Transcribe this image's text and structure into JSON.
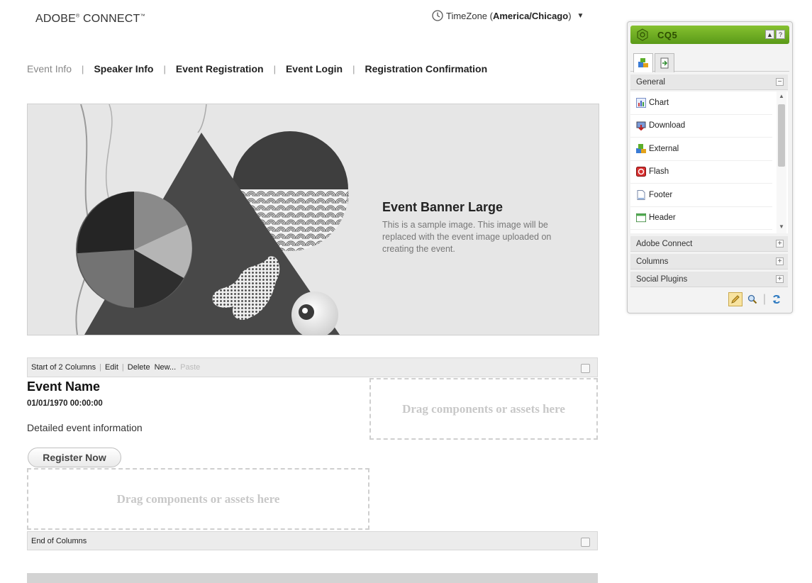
{
  "header": {
    "logo": "ADOBE",
    "logo_reg": "®",
    "logo_rest": " CONNECT",
    "logo_tm": "™",
    "timezone_prefix": "TimeZone (",
    "timezone_value": "America/Chicago",
    "timezone_suffix": ")"
  },
  "nav": [
    {
      "label": "Event Info",
      "active": true
    },
    {
      "label": "Speaker Info"
    },
    {
      "label": "Event Registration"
    },
    {
      "label": "Event Login"
    },
    {
      "label": "Registration Confirmation"
    }
  ],
  "nav_separator": "|",
  "banner": {
    "title": "Event Banner Large",
    "text": "This is a sample image. This image will be replaced with the event image uploaded on creating the event."
  },
  "columns": {
    "start_label": "Start of 2 Columns",
    "edit": "Edit",
    "delete": "Delete",
    "new": "New...",
    "paste": "Paste",
    "end_label": "End of Columns"
  },
  "event": {
    "name": "Event Name",
    "datetime": "01/01/1970 00:00:00",
    "details": "Detailed event information",
    "register_label": "Register Now"
  },
  "dropzone_text": "Drag components or assets here",
  "sidekick": {
    "title": "CQ5",
    "btn_up": "▲",
    "btn_help": "?",
    "group_general": "General",
    "components": [
      "Chart",
      "Download",
      "External",
      "Flash",
      "Footer",
      "Header"
    ],
    "groups": [
      "Adobe Connect",
      "Columns",
      "Social Plugins"
    ],
    "collapse_symbol": "−",
    "expand_symbol": "+"
  }
}
